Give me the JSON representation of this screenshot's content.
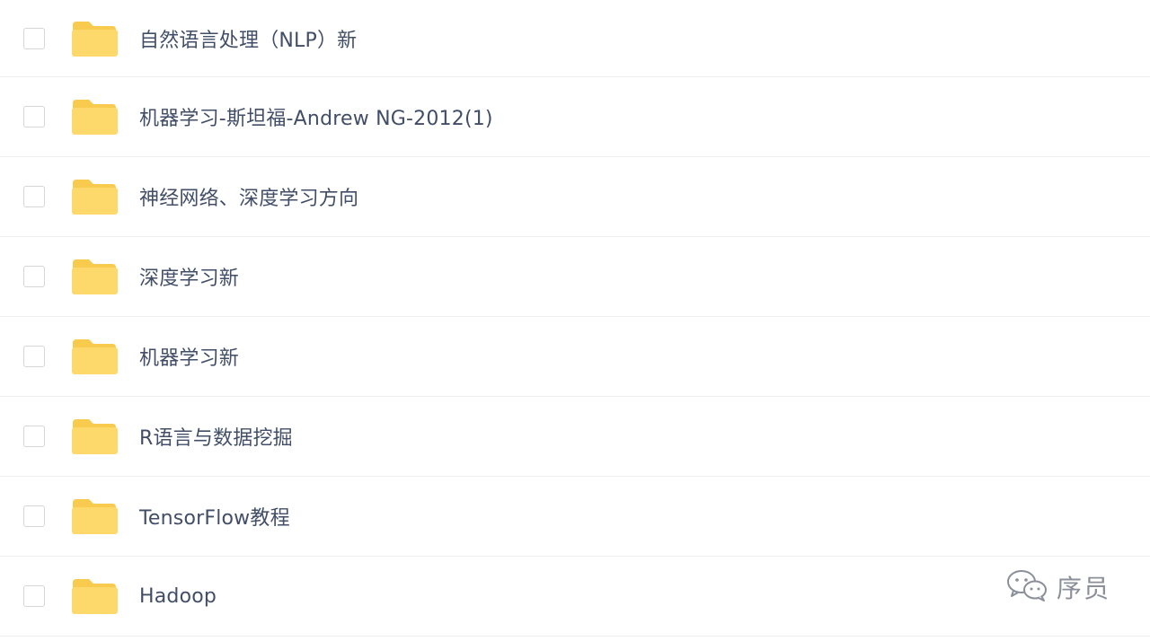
{
  "folders": [
    {
      "name": "自然语言处理（NLP）新"
    },
    {
      "name": "机器学习-斯坦福-Andrew NG-2012(1)"
    },
    {
      "name": "神经网络、深度学习方向"
    },
    {
      "name": "深度学习新"
    },
    {
      "name": "机器学习新"
    },
    {
      "name": "R语言与数据挖掘"
    },
    {
      "name": "TensorFlow教程"
    },
    {
      "name": "Hadoop"
    }
  ],
  "watermark": {
    "text": "序员",
    "icon": "wechat-icon"
  },
  "colors": {
    "folder_body": "#fdd86a",
    "folder_tab": "#f8cb4e",
    "text": "#424e67",
    "divider": "#eeeeee",
    "checkbox_border": "#d6d6d6"
  }
}
